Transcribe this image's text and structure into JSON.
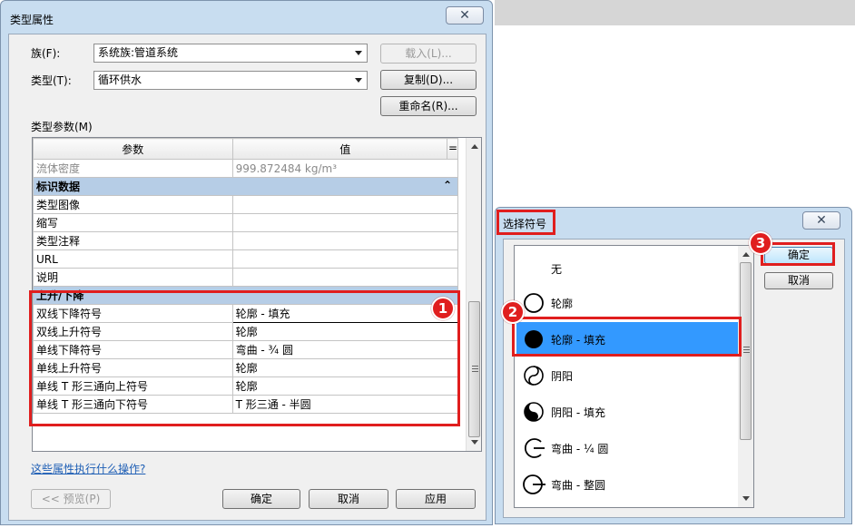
{
  "dialog": {
    "title": "类型属性",
    "close": "✕",
    "family_label": "族(F):",
    "family_value": "系统族:管道系统",
    "type_label": "类型(T):",
    "type_value": "循环供水",
    "load_button": "载入(L)...",
    "duplicate_button": "复制(D)...",
    "rename_button": "重命名(R)...",
    "type_params_label": "类型参数(M)",
    "columns": {
      "param": "参数",
      "value": "值",
      "eq": "="
    },
    "rows": {
      "fluid_density": {
        "param": "流体密度",
        "value": "999.872484 kg/m³"
      },
      "group_identity": "标识数据",
      "type_image": {
        "param": "类型图像",
        "value": ""
      },
      "type_mark": {
        "param": "缩写",
        "value": ""
      },
      "type_comments": {
        "param": "类型注释",
        "value": ""
      },
      "url": {
        "param": "URL",
        "value": ""
      },
      "description": {
        "param": "说明",
        "value": ""
      },
      "group_rise_drop": "上升/下降",
      "two_line_drop": {
        "param": "双线下降符号",
        "value": "轮廓 - 填充"
      },
      "two_line_rise": {
        "param": "双线上升符号",
        "value": "轮廓"
      },
      "single_line_drop": {
        "param": "单线下降符号",
        "value": "弯曲 - ¾ 圆"
      },
      "single_line_rise": {
        "param": "单线上升符号",
        "value": "轮廓"
      },
      "single_tee_up": {
        "param": "单线 T 形三通向上符号",
        "value": "轮廓"
      },
      "single_tee_down": {
        "param": "单线 T 形三通向下符号",
        "value": "T 形三通 - 半圆"
      }
    },
    "collapse_glyph": "⌃",
    "help_link": "这些属性执行什么操作?",
    "preview_button": "<< 预览(P)",
    "ok_button": "确定",
    "cancel_button": "取消",
    "apply_button": "应用"
  },
  "symbol_dialog": {
    "title": "选择符号",
    "close": "✕",
    "ok_button": "确定",
    "cancel_button": "取消",
    "items": [
      "无",
      "轮廓",
      "轮廓 - 填充",
      "阴阳",
      "阴阳 - 填充",
      "弯曲 - ¼ 圆",
      "弯曲 - 整圆"
    ]
  },
  "badges": [
    "1",
    "2",
    "3"
  ],
  "colors": {
    "highlight": "#e01e1e",
    "selection": "#3399ff",
    "group_header": "#b6cde6",
    "title_bar": "#c8ddf0"
  }
}
